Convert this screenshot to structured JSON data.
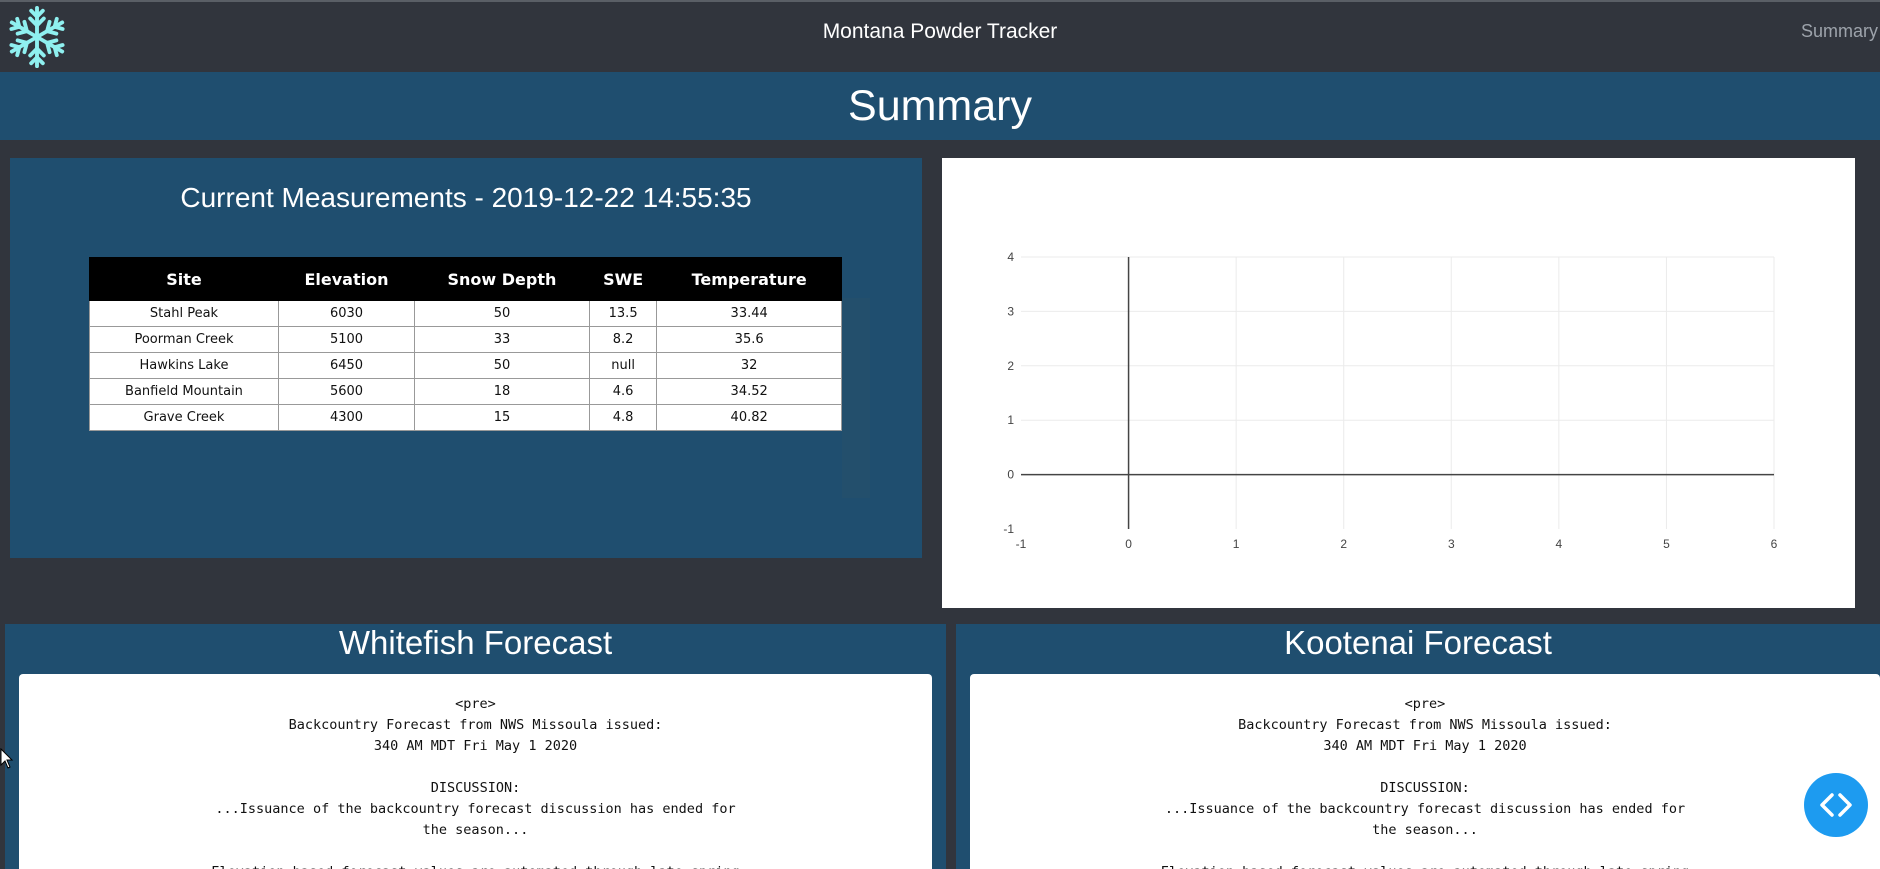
{
  "header": {
    "title": "Montana Powder Tracker",
    "nav_link": "Summary"
  },
  "banner": {
    "title": "Summary"
  },
  "measurements": {
    "title": "Current Measurements - 2019-12-22 14:55:35",
    "columns": [
      "Site",
      "Elevation",
      "Snow Depth",
      "SWE",
      "Temperature"
    ],
    "rows": [
      [
        "Stahl Peak",
        "6030",
        "50",
        "13.5",
        "33.44"
      ],
      [
        "Poorman Creek",
        "5100",
        "33",
        "8.2",
        "35.6"
      ],
      [
        "Hawkins Lake",
        "6450",
        "50",
        "null",
        "32"
      ],
      [
        "Banfield Mountain",
        "5600",
        "18",
        "4.6",
        "34.52"
      ],
      [
        "Grave Creek",
        "4300",
        "15",
        "4.8",
        "40.82"
      ]
    ]
  },
  "chart_data": {
    "type": "line",
    "series": [],
    "xlim": [
      -1,
      6
    ],
    "ylim": [
      -1,
      4
    ],
    "xticks": [
      "-1",
      "0",
      "1",
      "2",
      "3",
      "4",
      "5",
      "6"
    ],
    "yticks": [
      "-1",
      "0",
      "1",
      "2",
      "3",
      "4"
    ],
    "grid": true
  },
  "forecasts": [
    {
      "title": "Whitefish Forecast",
      "text": "<pre>\nBackcountry Forecast from NWS Missoula issued:\n340 AM MDT Fri May 1 2020\n\nDISCUSSION:\n...Issuance of the backcountry forecast discussion has ended for\nthe season...\n\nElevation-based forecast values are automated through late spring"
    },
    {
      "title": "Kootenai Forecast",
      "text": "<pre>\nBackcountry Forecast from NWS Missoula issued:\n340 AM MDT Fri May 1 2020\n\nDISCUSSION:\n...Issuance of the backcountry forecast discussion has ended for\nthe season...\n\nElevation-based forecast values are automated through late spring"
    }
  ],
  "icons": {
    "logo": "snowflake-icon",
    "fab": "code-icon",
    "cursor": "mouse-cursor-icon"
  },
  "colors": {
    "page_bg": "#31353d",
    "panel_blue": "#1f4e6f",
    "fab_blue": "#1d9bf0",
    "snowflake": "#8ff0f0"
  }
}
